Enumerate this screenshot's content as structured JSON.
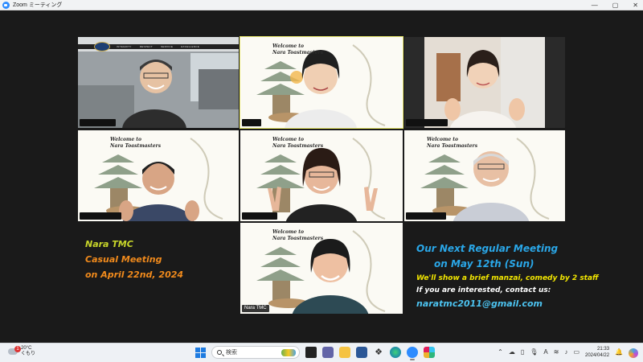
{
  "window": {
    "title": "Zoom ミーティング",
    "minimize": "—",
    "maximize": "▢",
    "close": "✕"
  },
  "participants": [
    {
      "id": "p1",
      "name": "",
      "redacted": true,
      "background": "office"
    },
    {
      "id": "p2",
      "name": "",
      "redacted": true,
      "background": "welcome",
      "active_speaker": true
    },
    {
      "id": "p3",
      "name": "",
      "redacted": true,
      "background": "room"
    },
    {
      "id": "p4",
      "name": "",
      "redacted": true,
      "background": "welcome"
    },
    {
      "id": "p5",
      "name": "",
      "redacted": true,
      "background": "welcome"
    },
    {
      "id": "p6",
      "name": "",
      "redacted": true,
      "background": "welcome"
    },
    {
      "id": "p7",
      "name": "Nara TMC",
      "redacted": false,
      "background": "welcome"
    }
  ],
  "virtual_bg": {
    "line1": "Welcome to",
    "line2": "Nara Toastmasters"
  },
  "office_banner": {
    "words": [
      "INTEGRITY",
      "RESPECT",
      "SERVICE",
      "EXCELLENCE"
    ]
  },
  "left_caption": {
    "line1": "Nara TMC",
    "line2": "Casual Meeting",
    "line3": "on April 22nd, 2024",
    "colors": {
      "line1": "#c8d62a",
      "line2": "#f08a1c",
      "line3": "#f08a1c"
    }
  },
  "right_caption": {
    "heading": "Our Next Regular Meeting",
    "date": "on May 12th (Sun)",
    "note": "We'll show a brief manzai, comedy by 2 staff",
    "contact": "If you are interested, contact us:",
    "email": "naratmc2011@gmail.com",
    "colors": {
      "heading": "#2aa7e8",
      "date": "#2aa7e8",
      "note": "#f2e600",
      "contact": "#ffffff",
      "email": "#4cc3f0"
    }
  },
  "taskbar": {
    "weather": {
      "temp": "20°C",
      "condition": "くもり",
      "badge": "1"
    },
    "search_placeholder": "検索",
    "apps": [
      "start",
      "search",
      "widgets",
      "teams",
      "file-explorer",
      "store",
      "dropbox",
      "edge",
      "zoom",
      "slack"
    ],
    "time": "21:33",
    "date": "2024/04/22",
    "ime": "A"
  }
}
